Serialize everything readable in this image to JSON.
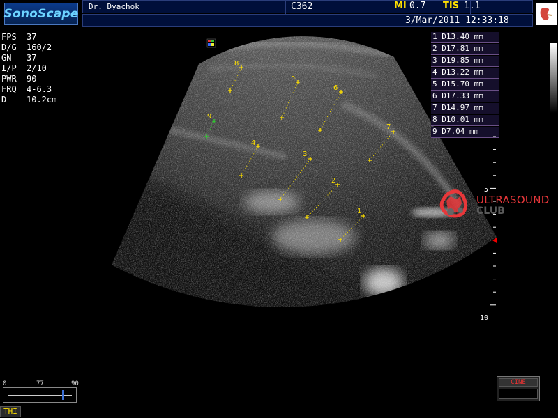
{
  "header": {
    "brand": "SonoScape",
    "doctor": "Dr. Dyachok",
    "probe": "C362",
    "mi_label": "MI",
    "mi_value": "0.7",
    "tis_label": "TIS",
    "tis_value": "1.1",
    "datetime": "3/Mar/2011 12:33:18"
  },
  "params": [
    {
      "key": "FPS",
      "value": "37"
    },
    {
      "key": "D/G",
      "value": "160/2"
    },
    {
      "key": "GN",
      "value": "37"
    },
    {
      "key": "I/P",
      "value": "2/10"
    },
    {
      "key": "PWR",
      "value": "90"
    },
    {
      "key": "FRQ",
      "value": "4-6.3"
    },
    {
      "key": "D",
      "value": "10.2cm"
    }
  ],
  "measurements": [
    "1 D13.40 mm",
    "2 D17.81 mm",
    "3 D19.85 mm",
    "4 D13.22 mm",
    "5 D15.70 mm",
    "6 D17.33 mm",
    "7 D14.97 mm",
    "8 D10.01 mm",
    "9 D7.04 mm"
  ],
  "caliper_labels": [
    "1",
    "2",
    "3",
    "4",
    "5",
    "6",
    "7",
    "8",
    "9"
  ],
  "depth_scale": {
    "mark_5": "5",
    "mark_10": "10"
  },
  "watermark": {
    "title": "ULTRASOUND",
    "subtitle": "CLUB"
  },
  "cine_label": "CINE",
  "gain_scale": {
    "labels": [
      "0",
      "77",
      "90"
    ],
    "level": 77,
    "max": 90
  },
  "thi_label": "THI",
  "colors": {
    "caliper": "#ffe000",
    "caliper_green": "#2fd02f",
    "header_bg": "#000f3a",
    "accent_red": "#e8373a"
  },
  "icons": [
    "probe-orientation-icon",
    "kidney-body-mark-icon",
    "ultrasound-club-logo-icon",
    "focus-marker-icon"
  ]
}
